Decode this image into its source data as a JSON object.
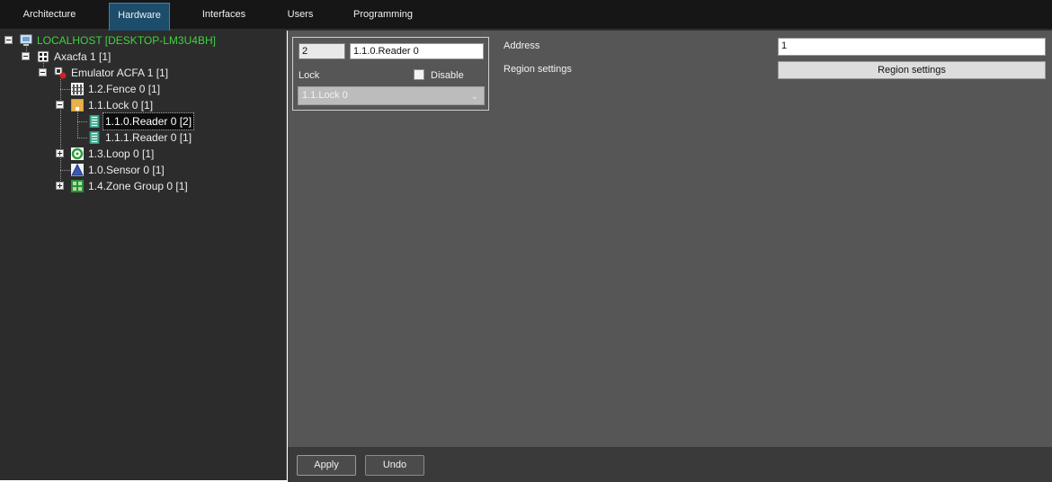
{
  "tabs": [
    {
      "label": "Architecture"
    },
    {
      "label": "Hardware"
    },
    {
      "label": "Interfaces"
    },
    {
      "label": "Users"
    },
    {
      "label": "Programming"
    }
  ],
  "active_tab": "Hardware",
  "tree": {
    "items": [
      {
        "label": "LOCALHOST [DESKTOP-LM3U4BH]",
        "icon": "computer-icon",
        "expanded": true
      },
      {
        "label": "Axacfa 1 [1]",
        "icon": "controller-board-icon",
        "expanded": true
      },
      {
        "label": "Emulator ACFA 1 [1]",
        "icon": "emulator-device-icon",
        "expanded": true
      },
      {
        "label": "1.2.Fence 0 [1]",
        "icon": "fence-icon"
      },
      {
        "label": "1.1.Lock 0 [1]",
        "icon": "lock-icon",
        "expanded": true
      },
      {
        "label": "1.1.0.Reader 0 [2]",
        "icon": "reader-icon",
        "selected": true
      },
      {
        "label": "1.1.1.Reader 0 [1]",
        "icon": "reader-icon"
      },
      {
        "label": "1.3.Loop 0 [1]",
        "icon": "loop-icon",
        "expanded": false
      },
      {
        "label": "1.0.Sensor 0 [1]",
        "icon": "sensor-icon"
      },
      {
        "label": "1.4.Zone Group 0 [1]",
        "icon": "zone-group-icon",
        "expanded": false
      }
    ]
  },
  "object_card": {
    "id_value": "2",
    "name_value": "1.1.0.Reader 0",
    "parent_label": "Lock",
    "disable_label": "Disable",
    "parent_value": "1.1.Lock 0"
  },
  "properties": {
    "address_label": "Address",
    "address_value": "1",
    "region_label": "Region settings",
    "region_button": "Region settings"
  },
  "actions": {
    "apply": "Apply",
    "undo": "Undo"
  },
  "colors": {
    "active_tab": "#1c4d6b",
    "root_node_text": "#3ed33e",
    "panel_bg": "#565656",
    "tree_bg": "#2c2c2c"
  }
}
